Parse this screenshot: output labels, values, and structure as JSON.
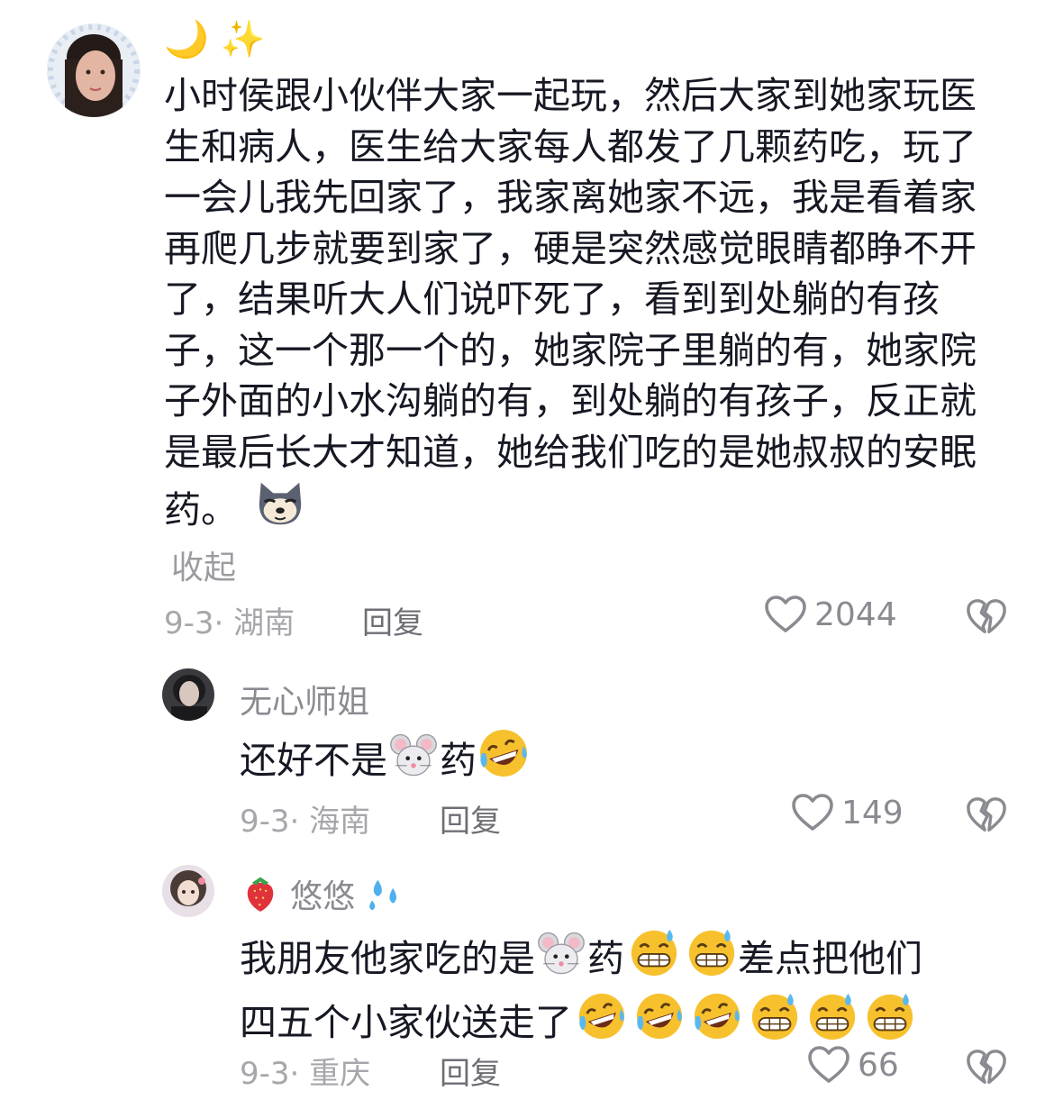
{
  "comments": [
    {
      "name": "🌙 ✨",
      "text": "小时侯跟小伙伴大家一起玩，然后大家到她家玩医生和病人，医生给大家每人都发了几颗药吃，玩了一会儿我先回家了，我家离她家不远，我是看着家再爬几步就要到家了，硬是突然感觉眼睛都睁不开了，结果听大人们说吓死了，看到到处躺的有孩子，这一个那一个的，她家院子里躺的有，她家院子外面的小水沟躺的有，到处躺的有孩子，反正就是最后长大才知道，她给我们吃的是她叔叔的安眠药。",
      "collapse": "收起",
      "date": "9-3",
      "location": "· 湖南",
      "reply": "回复",
      "likes": "2044"
    },
    {
      "name": "无心师姐",
      "text_a": "还好不是",
      "text_b": "药",
      "date": "9-3",
      "location": "· 海南",
      "reply": "回复",
      "likes": "149"
    },
    {
      "name": "悠悠",
      "line1_a": "我朋友他家吃的是",
      "line1_b": "药",
      "line1_c": "差点把他们",
      "line2": "四五个小家伙送走了",
      "date": "9-3",
      "location": "· 重庆",
      "reply": "回复",
      "likes": "66"
    }
  ],
  "icons": {
    "like": "heart-outline-icon",
    "dislike": "broken-heart-icon",
    "emoji_dog": "doge-emoji",
    "emoji_mouse": "mouse-emoji",
    "emoji_laugh_cry": "laugh-cry-emoji",
    "emoji_sweat": "sweat-smile-emoji",
    "emoji_strawberry": "strawberry-emoji",
    "emoji_sweat_drops": "sweat-drops-emoji"
  }
}
